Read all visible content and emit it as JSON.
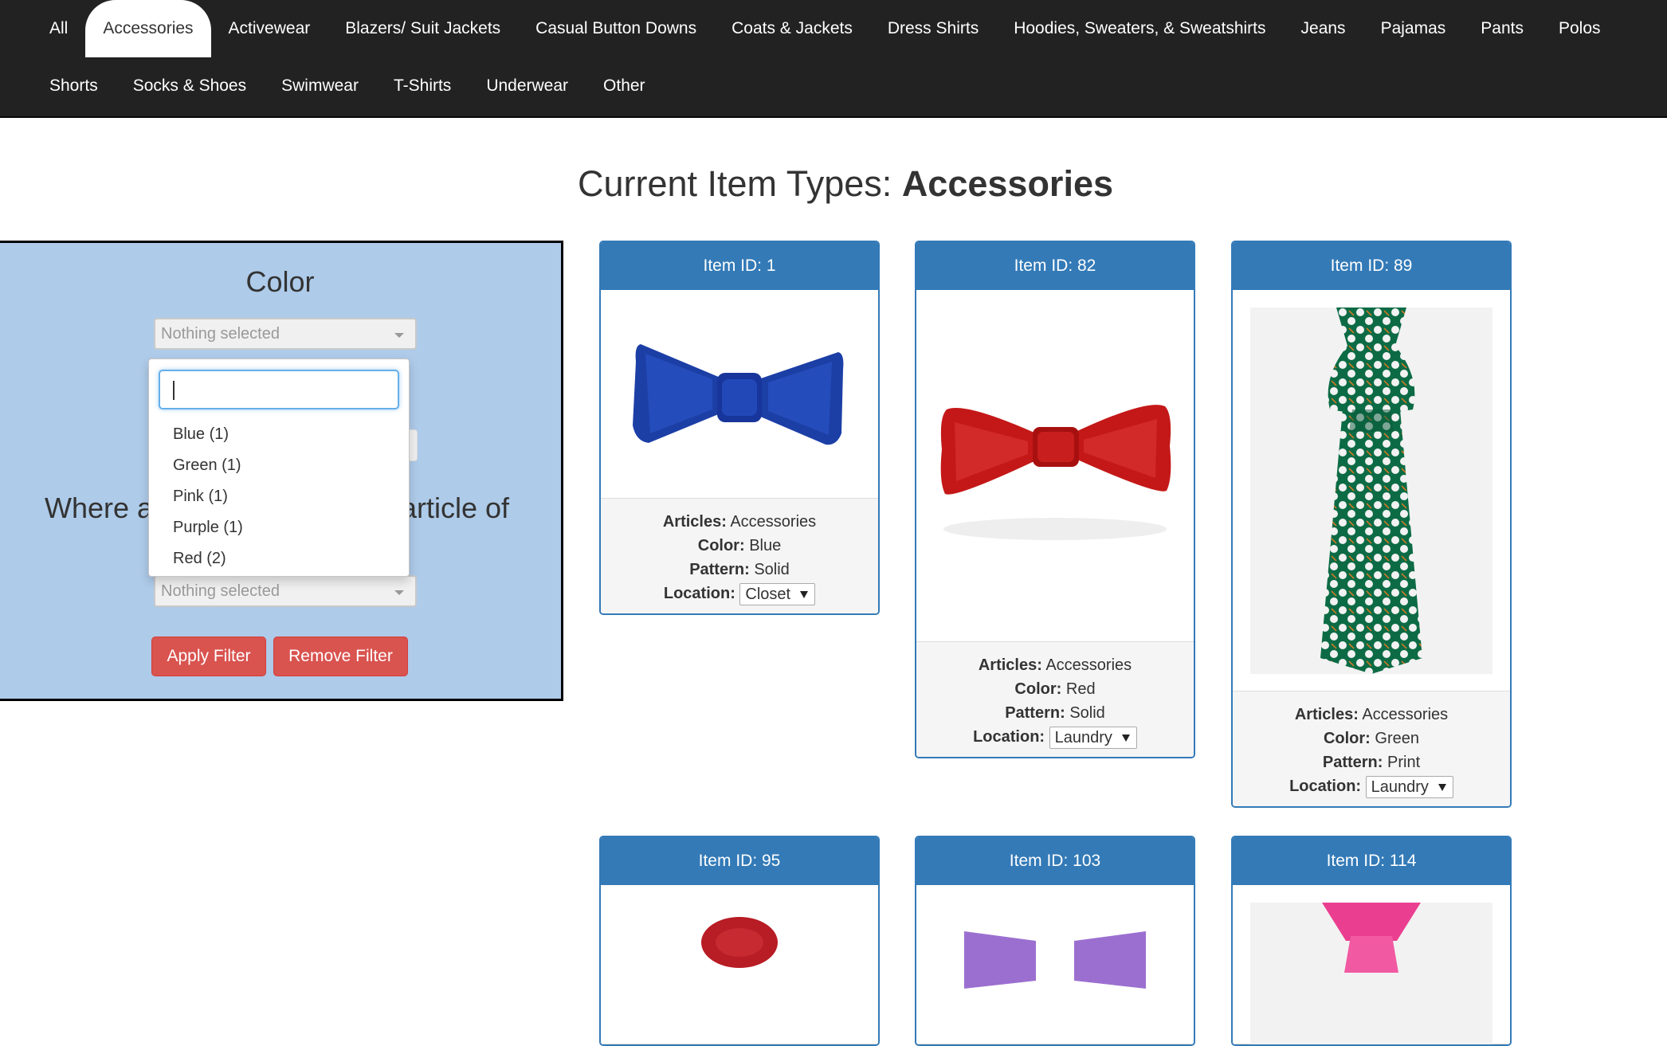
{
  "nav": {
    "row1": [
      "All",
      "Accessories",
      "Activewear",
      "Blazers/ Suit Jackets",
      "Casual Button Downs",
      "Coats & Jackets",
      "Dress Shirts",
      "Hoodies, Sweaters, & Sweatshirts",
      "Jeans",
      "Pajamas",
      "Pants",
      "Polos"
    ],
    "row2": [
      "Shorts",
      "Socks & Shoes",
      "Swimwear",
      "T-Shirts",
      "Underwear",
      "Other"
    ],
    "active": "Accessories"
  },
  "title": {
    "prefix": "Current Item Types:",
    "value": "Accessories"
  },
  "filter": {
    "heading": "Color",
    "select1_placeholder": "Nothing selected",
    "select2_placeholder": "Nothing selected",
    "where_left": "Where a",
    "where_right": "article of",
    "apply_label": "Apply Filter",
    "remove_label": "Remove Filter",
    "dropdown_options": [
      "Blue (1)",
      "Green (1)",
      "Pink (1)",
      "Purple (1)",
      "Red (2)"
    ]
  },
  "labels": {
    "articles": "Articles:",
    "color": "Color:",
    "pattern": "Pattern:",
    "location": "Location:"
  },
  "cards": [
    {
      "id_label": "Item ID: 1",
      "articles": "Accessories",
      "color": "Blue",
      "pattern": "Solid",
      "location": "Closet",
      "image": "blue-bowtie"
    },
    {
      "id_label": "Item ID: 82",
      "articles": "Accessories",
      "color": "Red",
      "pattern": "Solid",
      "location": "Laundry",
      "image": "red-bowtie"
    },
    {
      "id_label": "Item ID: 89",
      "articles": "Accessories",
      "color": "Green",
      "pattern": "Print",
      "location": "Laundry",
      "image": "green-tie"
    },
    {
      "id_label": "Item ID: 95",
      "image": "red-paisley"
    },
    {
      "id_label": "Item ID: 103",
      "image": "purple-bowtie"
    },
    {
      "id_label": "Item ID: 114",
      "image": "pink-tie"
    }
  ],
  "colors": {
    "nav_bg": "#222222",
    "panel_bg": "#aecbe9",
    "card_primary": "#337ab7",
    "button_danger": "#d9534f"
  }
}
